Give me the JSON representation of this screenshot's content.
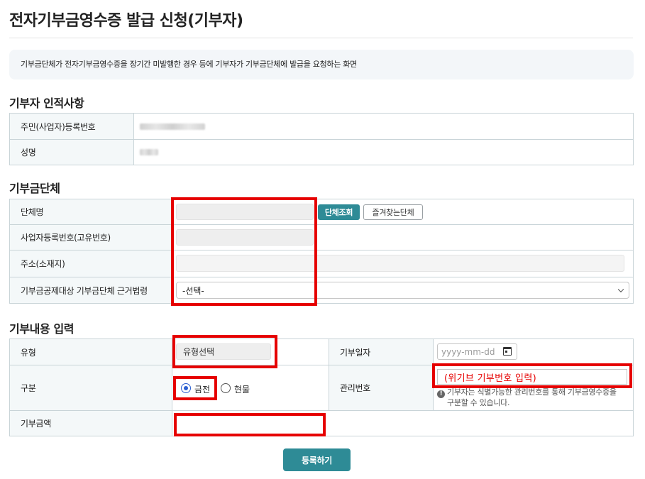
{
  "page": {
    "title": "전자기부금영수증 발급 신청(기부자)",
    "description": "기부금단체가 전자기부금영수증을 장기간 미발행한 경우 등에 기부자가 기부금단체에 발급을 요청하는 화면"
  },
  "donor": {
    "section_title": "기부자 인적사항",
    "id_label": "주민(사업자)등록번호",
    "name_label": "성명"
  },
  "org": {
    "section_title": "기부금단체",
    "name_label": "단체명",
    "search_button": "단체조회",
    "favorites_button": "즐겨찾는단체",
    "bizno_label": "사업자등록번호(고유번호)",
    "address_label": "주소(소재지)",
    "law_label": "기부금공제대상 기부금단체 근거법령",
    "law_selected": "-선택-"
  },
  "donation": {
    "section_title": "기부내용 입력",
    "type_label": "유형",
    "type_value": "유형선택",
    "date_label": "기부일자",
    "date_placeholder": "yyyy-mm-dd",
    "kind_label": "구분",
    "kind_cash": "금전",
    "kind_goods": "현물",
    "kind_selected": "금전",
    "mgmt_label": "관리번호",
    "mgmt_value": "(위기브 기부번호 입력)",
    "mgmt_help_line1": "기부자는 식별가능한 관리번호를 통해 기부금영수증을",
    "mgmt_help_line2": "구분할 수 있습니다.",
    "amount_label": "기부금액"
  },
  "actions": {
    "submit_label": "등록하기"
  },
  "colors": {
    "accent": "#2e8b96",
    "highlight": "#e60000",
    "header_bg": "#f4f8f9",
    "radio_selected": "#2c5fd1"
  },
  "icons": {
    "calendar": "calendar-icon",
    "help": "info-icon",
    "dropdown": "chevron-down-icon"
  }
}
